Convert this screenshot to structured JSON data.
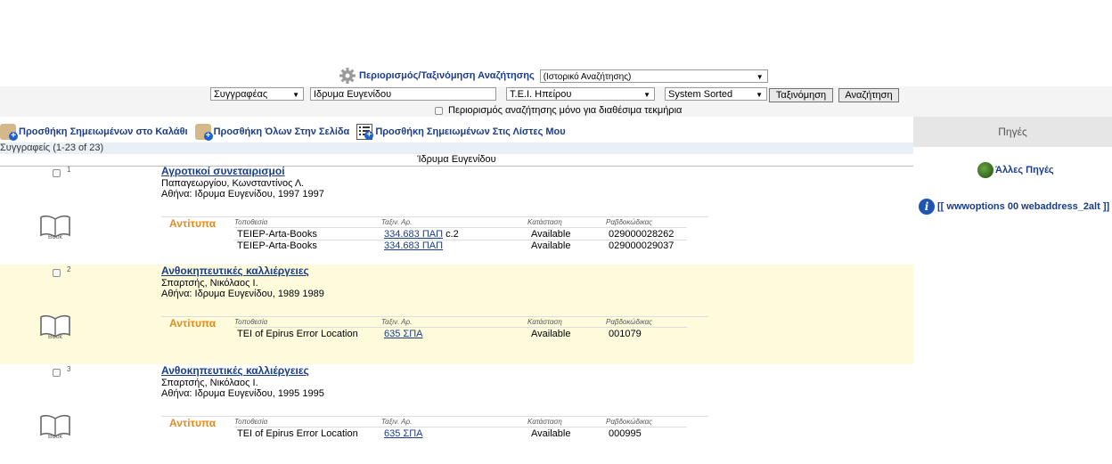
{
  "search": {
    "limit_link": "Περιορισμός/Ταξινόμηση Αναζήτησης",
    "history_select": "(Ιστορικό Αναζήτησης)",
    "field_select": "Συγγραφέας",
    "query_value": "Ιδρυμα Ευγενίδου",
    "library_select": "Τ.Ε.Ι. Ηπείρου",
    "sort_select": "System Sorted",
    "sort_button": "Ταξινόμηση",
    "search_button": "Αναζήτηση",
    "available_only_label": "Περιορισμός αναζήτησης μόνο για διαθέσιμα τεκμήρια"
  },
  "actions": {
    "add_marked_cart": "Προσθήκη Σημειωμένων στο Καλάθι",
    "add_all_page": "Προσθήκη Όλων Στην Σελίδα",
    "add_marked_lists": "Προσθήκη Σημειωμένων Στις Λίστες Μου"
  },
  "results": {
    "count": "Συγγραφείς (1-23 of 23)",
    "group_heading": "Ίδρυμα Ευγενίδου"
  },
  "holdings_headers": {
    "location": "Τοποθεσία",
    "callno": "Ταξιν. Αρ.",
    "status": "Κατάσταση",
    "barcode": "Ραβδοκώδικας"
  },
  "copies_label": "Αντίτυπα",
  "book_label": "Book",
  "records": [
    {
      "num": "1",
      "title": "Αγροτικοί συνεταιρισμοί",
      "author": "Παπαγεωργίου, Κωνσταντίνος Λ.",
      "publisher": "Αθήνα: Ιδρυμα Ευγενίδου, 1997 1997",
      "holdings": [
        {
          "location": "TEIEP-Arta-Books",
          "callno": "334.683 ΠΑΠ",
          "copy": "c.2",
          "status": "Available",
          "barcode": "029000028262"
        },
        {
          "location": "TEIEP-Arta-Books",
          "callno": "334.683 ΠΑΠ",
          "copy": "",
          "status": "Available",
          "barcode": "029000029037"
        }
      ]
    },
    {
      "num": "2",
      "title": "Ανθοκηπευτικές καλλιέργειες",
      "author": "Σπαρτσής, Νικόλαος Ι.",
      "publisher": "Αθήνα: Ιδρυμα Ευγενίδου, 1989 1989",
      "holdings": [
        {
          "location": "TEI of Epirus Error Location",
          "callno": "635 ΣΠΑ",
          "copy": "",
          "status": "Available",
          "barcode": "001079"
        }
      ]
    },
    {
      "num": "3",
      "title": "Ανθοκηπευτικές καλλιέργειες",
      "author": "Σπαρτσής, Νικόλαος Ι.",
      "publisher": "Αθήνα: Ιδρυμα Ευγενίδου, 1995 1995",
      "holdings": [
        {
          "location": "TEI of Epirus Error Location",
          "callno": "635 ΣΠΑ",
          "copy": "",
          "status": "Available",
          "barcode": "000995"
        }
      ]
    }
  ],
  "sidebar": {
    "heading": "Πηγές",
    "other_sources": "Άλλες Πηγές",
    "wwwoptions": "[[ wwwoptions 00 webaddress_2alt ]]"
  }
}
